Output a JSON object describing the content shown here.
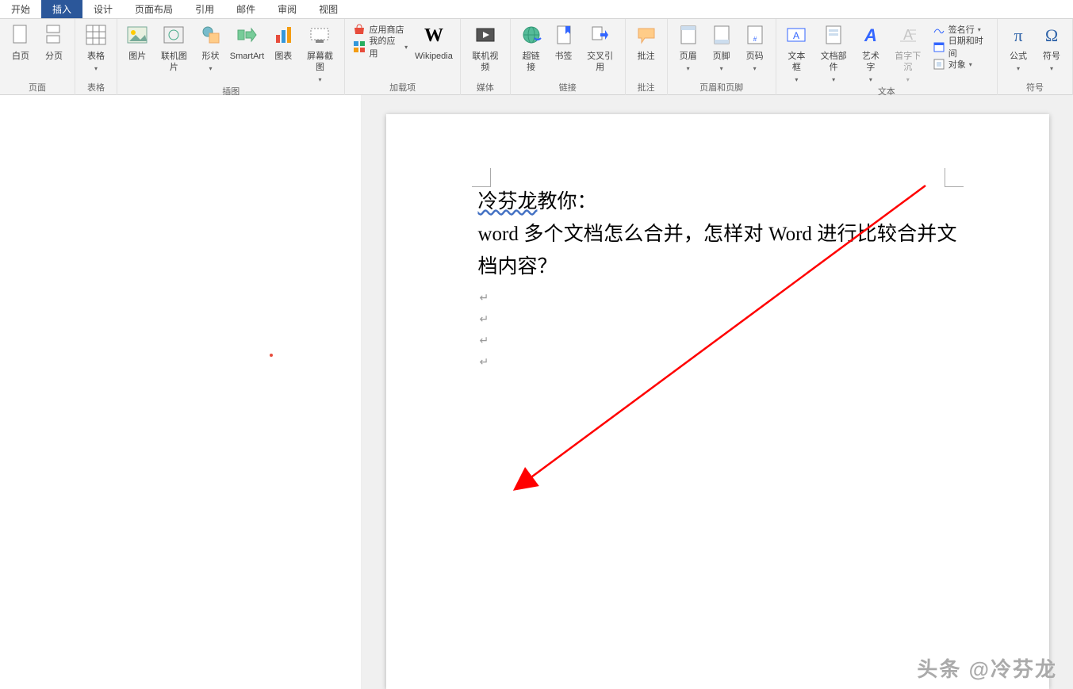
{
  "tabs": [
    "开始",
    "插入",
    "设计",
    "页面布局",
    "引用",
    "邮件",
    "审阅",
    "视图"
  ],
  "active_tab": 1,
  "groups": {
    "pages": {
      "label": "页面",
      "blank": "白页",
      "break": "分页"
    },
    "tables": {
      "label": "表格",
      "tables": "表格"
    },
    "illus": {
      "label": "插图",
      "pic": "图片",
      "online": "联机图片",
      "shapes": "形状",
      "smartart": "SmartArt",
      "chart": "图表",
      "screenshot": "屏幕截图"
    },
    "apps": {
      "label": "加载项",
      "store": "应用商店",
      "myapps": "我的应用",
      "wiki": "Wikipedia"
    },
    "media": {
      "label": "媒体",
      "video": "联机视频"
    },
    "links": {
      "label": "链接",
      "hyper": "超链接",
      "bookmark": "书签",
      "cross": "交叉引用"
    },
    "comments": {
      "label": "批注",
      "comment": "批注"
    },
    "header": {
      "label": "页眉和页脚",
      "hdr": "页眉",
      "ftr": "页脚",
      "num": "页码"
    },
    "text": {
      "label": "文本",
      "textbox": "文本框",
      "parts": "文档部件",
      "wordart": "艺术字",
      "dropcap": "首字下沉",
      "sig": "签名行",
      "dt": "日期和时间",
      "obj": "对象"
    },
    "symbols": {
      "label": "符号",
      "eq": "公式",
      "sym": "符号"
    }
  },
  "doc": {
    "title_author": "冷芬龙",
    "title_suffix": "教你：",
    "body_line": "word 多个文档怎么合并，怎样对 Word 进行比较合并文档内容？"
  },
  "watermark": "头条 @冷芬龙"
}
